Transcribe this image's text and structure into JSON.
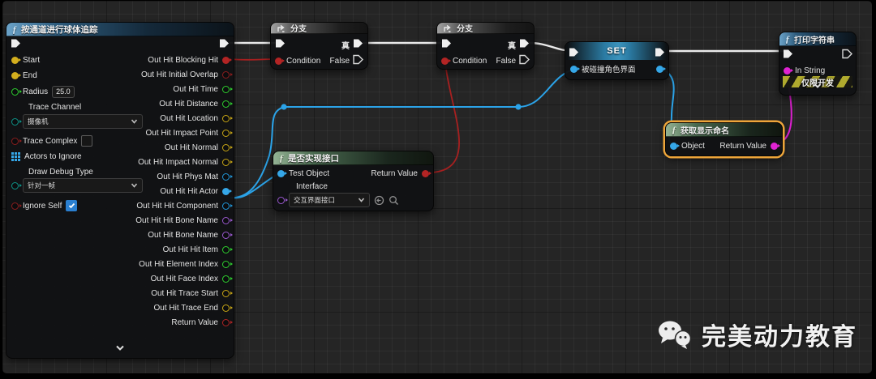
{
  "watermark": {
    "text": "完美动力教育"
  },
  "colors": {
    "selection": "#eda53a",
    "exec_wire": "#ebebeb",
    "bool_wire": "#a82020",
    "object_wire": "#2ba3e8",
    "string_wire": "#dd1fd0"
  },
  "sphere_trace": {
    "title": "按通道进行球体追踪",
    "start_label": "Start",
    "end_label": "End",
    "radius_label": "Radius",
    "radius_value": "25.0",
    "trace_channel_label": "Trace Channel",
    "trace_channel_value": "摄像机",
    "trace_complex_label": "Trace Complex",
    "actors_to_ignore_label": "Actors to Ignore",
    "draw_debug_label": "Draw Debug Type",
    "draw_debug_value": "针对一帧",
    "ignore_self_label": "Ignore Self",
    "out_pins": [
      {
        "label": "Out Hit Blocking Hit",
        "color": "#b32424",
        "filled": true
      },
      {
        "label": "Out Hit Initial Overlap",
        "color": "#8b1d1d",
        "filled": false
      },
      {
        "label": "Out Hit Time",
        "color": "#2fd12f",
        "filled": false
      },
      {
        "label": "Out Hit Distance",
        "color": "#2fd12f",
        "filled": false
      },
      {
        "label": "Out Hit Location",
        "color": "#c9a715",
        "filled": false
      },
      {
        "label": "Out Hit Impact Point",
        "color": "#c9a715",
        "filled": false
      },
      {
        "label": "Out Hit Normal",
        "color": "#c9a715",
        "filled": false
      },
      {
        "label": "Out Hit Impact Normal",
        "color": "#c9a715",
        "filled": false
      },
      {
        "label": "Out Hit Phys Mat",
        "color": "#2196d8",
        "filled": false
      },
      {
        "label": "Out Hit Hit Actor",
        "color": "#35a7e8",
        "filled": true
      },
      {
        "label": "Out Hit Hit Component",
        "color": "#2196d8",
        "filled": false
      },
      {
        "label": "Out Hit Hit Bone Name",
        "color": "#9b59d0",
        "filled": false
      },
      {
        "label": "Out Hit Bone Name",
        "color": "#9b59d0",
        "filled": false
      },
      {
        "label": "Out Hit Hit Item",
        "color": "#2fd12f",
        "filled": false
      },
      {
        "label": "Out Hit Element Index",
        "color": "#2fd12f",
        "filled": false
      },
      {
        "label": "Out Hit Face Index",
        "color": "#2fd12f",
        "filled": false
      },
      {
        "label": "Out Hit Trace Start",
        "color": "#c9a715",
        "filled": false
      },
      {
        "label": "Out Hit Trace End",
        "color": "#c9a715",
        "filled": false
      },
      {
        "label": "Return Value",
        "color": "#b32424",
        "filled": false
      }
    ]
  },
  "branch1": {
    "title": "分支",
    "condition_label": "Condition",
    "true_label": "真",
    "false_label": "False"
  },
  "branch2": {
    "title": "分支",
    "condition_label": "Condition",
    "true_label": "真",
    "false_label": "False"
  },
  "interface_check": {
    "title": "是否实现接口",
    "test_object_label": "Test Object",
    "return_value_label": "Return Value",
    "interface_label": "Interface",
    "interface_value": "交互界面接口"
  },
  "set_node": {
    "title": "SET",
    "var_label": "被碰撞角色界面"
  },
  "get_display_name": {
    "title": "获取显示命名",
    "object_label": "Object",
    "return_value_label": "Return Value"
  },
  "print_string": {
    "title": "打印字符串",
    "in_string_label": "In String",
    "dev_banner": "仅限开发"
  }
}
